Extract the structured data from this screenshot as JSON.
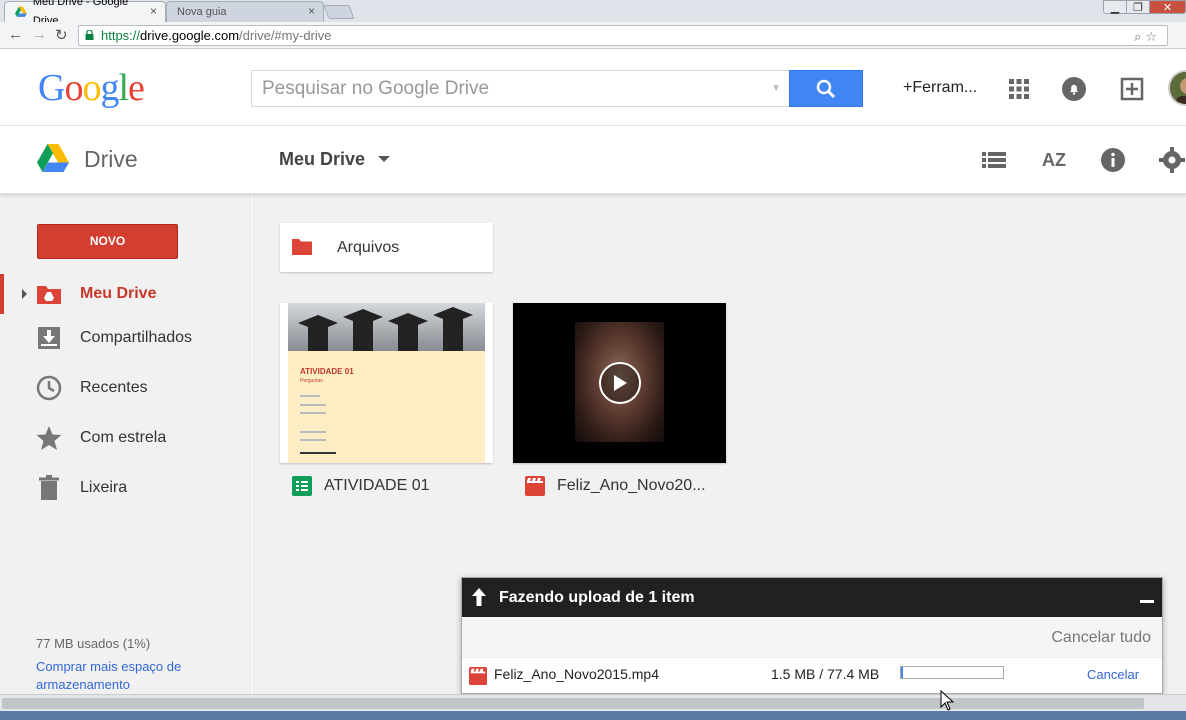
{
  "browser": {
    "tabs": [
      {
        "title": "Meu Drive - Google Drive",
        "active": true
      },
      {
        "title": "Nova guia",
        "active": false
      }
    ],
    "tab_close_glyph": "×",
    "window_controls": {
      "minimize": "▁",
      "maximize": "❐",
      "close": "✕"
    },
    "nav": {
      "back": "←",
      "forward": "→",
      "reload": "↻"
    },
    "url": {
      "scheme": "https://",
      "host": "drive.google.com",
      "path": "/drive/#my-drive"
    },
    "omnibox_icons": "⌕☆"
  },
  "header": {
    "logo_letters": [
      {
        "char": "G",
        "color": "#4285f4"
      },
      {
        "char": "o",
        "color": "#ea4335"
      },
      {
        "char": "o",
        "color": "#fbbc05"
      },
      {
        "char": "g",
        "color": "#4285f4"
      },
      {
        "char": "l",
        "color": "#34a853"
      },
      {
        "char": "e",
        "color": "#ea4335"
      }
    ],
    "search_placeholder": "Pesquisar no Google Drive",
    "search_caret": "▼",
    "tools_link": "+Ferram...",
    "icons": [
      "apps-grid-icon",
      "notifications-bell-icon",
      "share-add-icon",
      "avatar"
    ]
  },
  "subheader": {
    "product": "Drive",
    "breadcrumb": "Meu Drive",
    "icons": [
      "list-view-icon",
      "sort-az-icon",
      "info-icon",
      "settings-gear-icon"
    ],
    "sort_label": "AZ"
  },
  "sidebar": {
    "new_button": "NOVO",
    "items": [
      {
        "label": "Meu Drive",
        "icon": "my-drive-icon",
        "active": true
      },
      {
        "label": "Compartilhados",
        "icon": "shared-icon",
        "active": false
      },
      {
        "label": "Recentes",
        "icon": "clock-icon",
        "active": false
      },
      {
        "label": "Com estrela",
        "icon": "star-icon",
        "active": false
      },
      {
        "label": "Lixeira",
        "icon": "trash-icon",
        "active": false
      }
    ],
    "quota": "77 MB usados (1%)",
    "buy_more": "Comprar mais espaço de armazenamento"
  },
  "content": {
    "folders": [
      {
        "name": "Arquivos",
        "color": "#db4437"
      }
    ],
    "files": [
      {
        "name": "ATIVIDADE 01",
        "type": "spreadsheet",
        "color": "#0f9d58",
        "thumb_title": "ATIVIDADE 01",
        "thumb_subtitle": "Perguntas"
      },
      {
        "name": "Feliz_Ano_Novo20...",
        "type": "video",
        "color": "#db4437"
      }
    ]
  },
  "upload": {
    "title": "Fazendo upload de 1 item",
    "cancel_all": "Cancelar tudo",
    "items": [
      {
        "name": "Feliz_Ano_Novo2015.mp4",
        "size": "1.5 MB / 77.4 MB",
        "progress": 0.019,
        "cancel": "Cancelar"
      }
    ]
  }
}
